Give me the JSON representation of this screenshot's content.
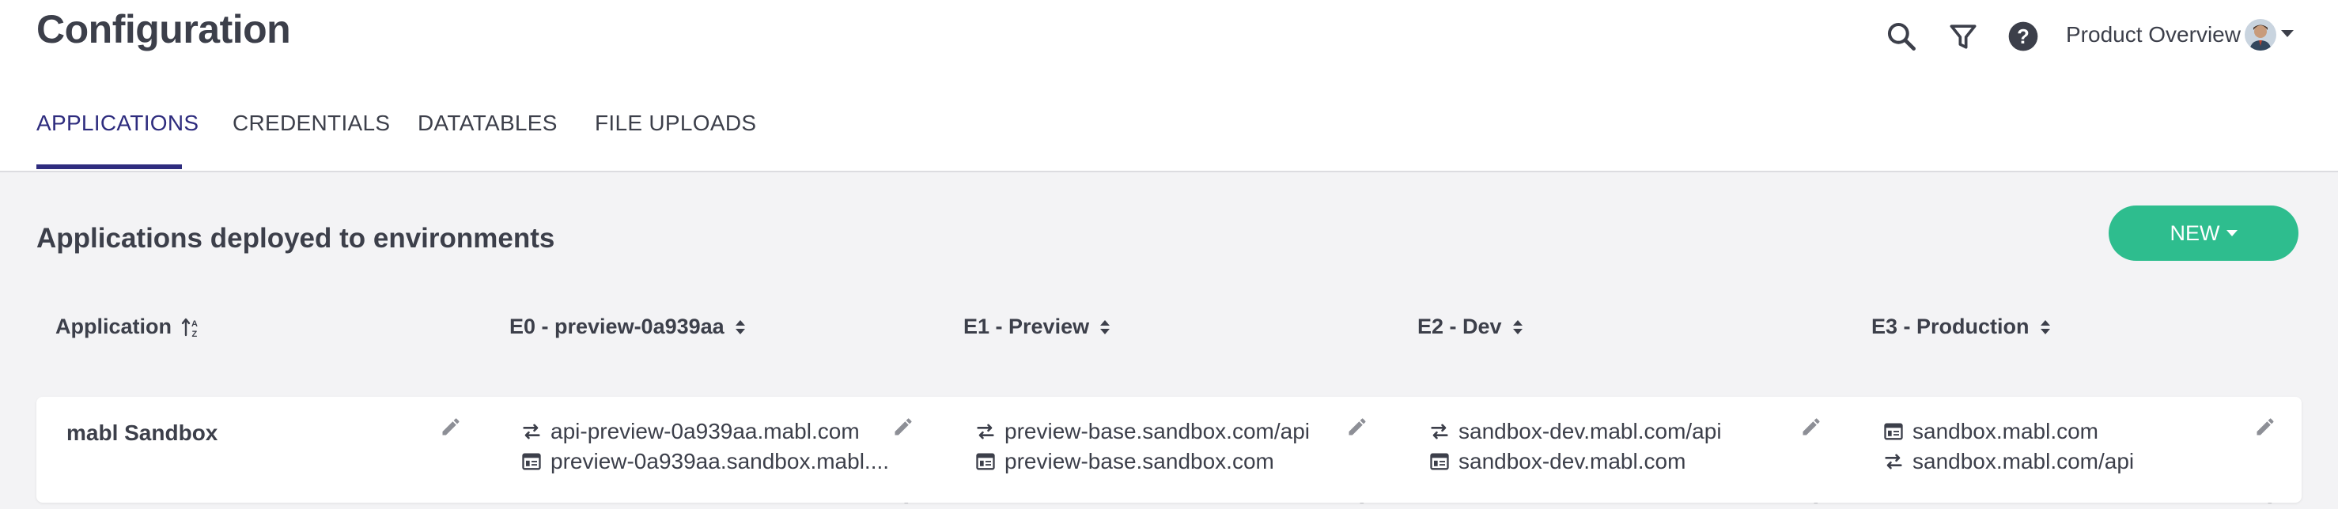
{
  "header": {
    "title": "Configuration",
    "tabs": [
      {
        "label": "APPLICATIONS",
        "active": true
      },
      {
        "label": "CREDENTIALS",
        "active": false
      },
      {
        "label": "DATATABLES",
        "active": false
      },
      {
        "label": "FILE UPLOADS",
        "active": false
      }
    ],
    "icons": [
      "search-icon",
      "filter-icon",
      "help-icon"
    ],
    "workspace": "Product Overview"
  },
  "main": {
    "section_title": "Applications deployed to environments",
    "new_button_label": "NEW",
    "columns": [
      {
        "label": "Application",
        "sort_icon": "sort-alpha-icon"
      },
      {
        "label": "E0 - preview-0a939aa",
        "sort_icon": "sort-icon"
      },
      {
        "label": "E1 - Preview",
        "sort_icon": "sort-icon"
      },
      {
        "label": "E2 - Dev",
        "sort_icon": "sort-icon"
      },
      {
        "label": "E3 - Production",
        "sort_icon": "sort-icon"
      }
    ],
    "rows": [
      {
        "application": "mabl Sandbox",
        "environments": [
          [
            {
              "icon": "api-icon",
              "url": "api-preview-0a939aa.mabl.com"
            },
            {
              "icon": "web-icon",
              "url": "preview-0a939aa.sandbox.mabl...."
            }
          ],
          [
            {
              "icon": "api-icon",
              "url": "preview-base.sandbox.com/api"
            },
            {
              "icon": "web-icon",
              "url": "preview-base.sandbox.com"
            }
          ],
          [
            {
              "icon": "api-icon",
              "url": "sandbox-dev.mabl.com/api"
            },
            {
              "icon": "web-icon",
              "url": "sandbox-dev.mabl.com"
            }
          ],
          [
            {
              "icon": "web-icon",
              "url": "sandbox.mabl.com"
            },
            {
              "icon": "api-icon",
              "url": "sandbox.mabl.com/api"
            }
          ]
        ]
      }
    ]
  },
  "colors": {
    "accent": "#2e2c7e",
    "new_button": "#2ebd8e",
    "text": "#3c3f4a",
    "background": "#f3f3f5"
  }
}
